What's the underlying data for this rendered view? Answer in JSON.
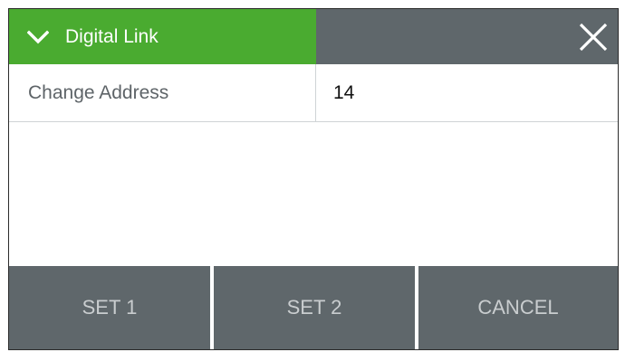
{
  "header": {
    "title": "Digital Link",
    "expand_icon": "chevron-down-icon",
    "close_icon": "close-icon",
    "accent_color": "#4aab30",
    "bar_color": "#5f676b"
  },
  "fields": [
    {
      "label": "Change Address",
      "value": "14"
    }
  ],
  "footer": {
    "buttons": [
      {
        "label": "SET 1"
      },
      {
        "label": "SET 2"
      },
      {
        "label": "CANCEL"
      }
    ]
  }
}
